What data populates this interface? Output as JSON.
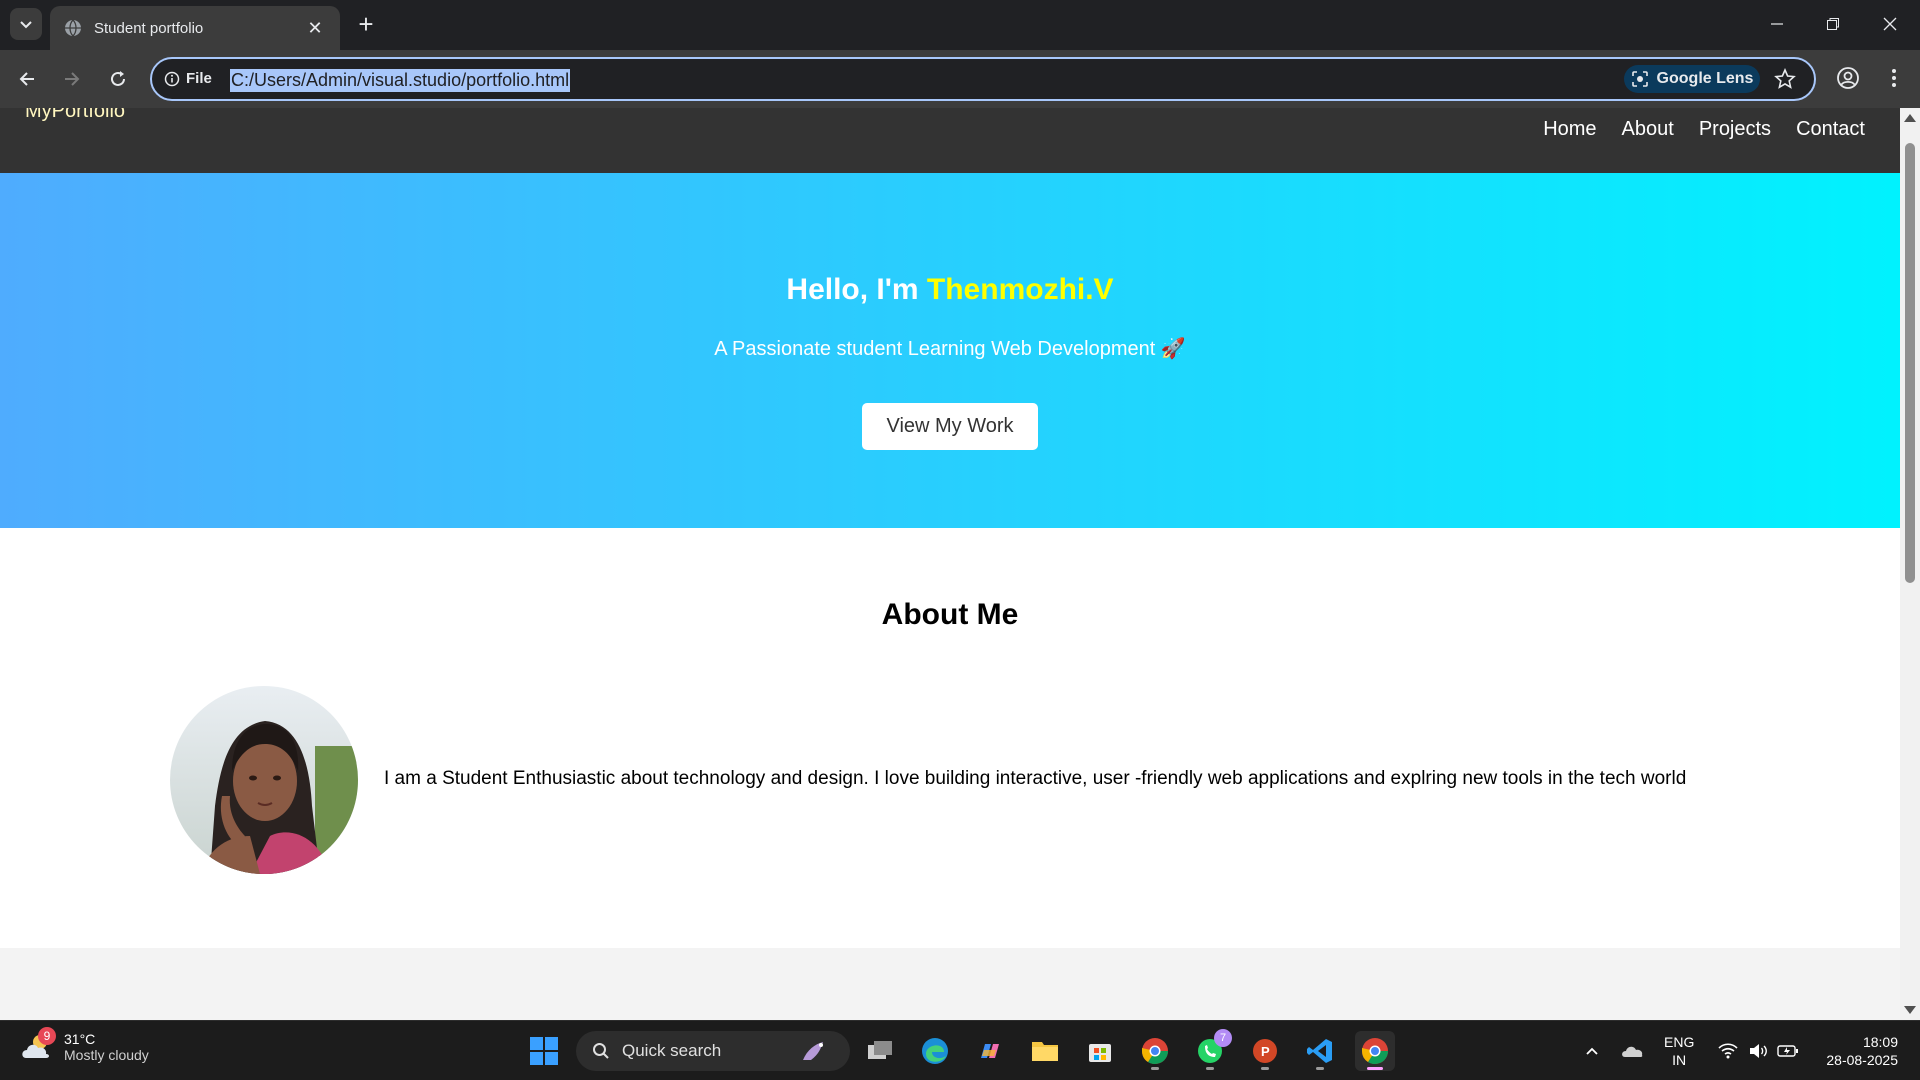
{
  "browser": {
    "tab_title": "Student portfolio",
    "omnibox_chip": "File",
    "url": "C:/Users/Admin/visual.studio/portfolio.html",
    "lens_label": "Google Lens"
  },
  "site": {
    "logo": "MyPortfolio",
    "nav": [
      "Home",
      "About",
      "Projects",
      "Contact"
    ],
    "hero": {
      "greeting": "Hello, I'm ",
      "name": "Thenmozhi.V",
      "tagline": "A Passionate student Learning Web Development 🚀",
      "cta": "View My Work"
    },
    "about": {
      "heading": "About Me",
      "text": "I am a Student Enthusiastic about technology and design. I love building interactive, user -friendly web applications and explring new tools in the tech world"
    }
  },
  "taskbar": {
    "weather_badge": "9",
    "temperature": "31°C",
    "condition": "Mostly cloudy",
    "search_label": "Quick search",
    "whatsapp_badge": "7",
    "lang_line1": "ENG",
    "lang_line2": "IN",
    "time": "18:09",
    "date": "28-08-2025"
  },
  "colors": {
    "hero_start": "#4facfe",
    "hero_end": "#00f2fe",
    "name_highlight": "#ffff00",
    "nav_bg": "#333333"
  }
}
